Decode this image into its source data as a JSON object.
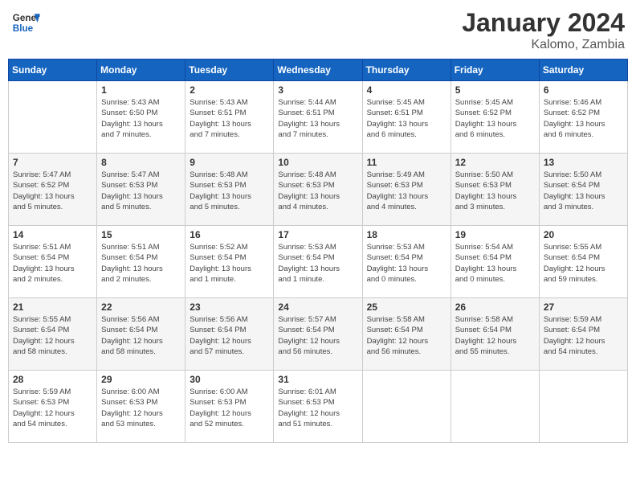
{
  "header": {
    "logo_general": "General",
    "logo_blue": "Blue",
    "month": "January 2024",
    "location": "Kalomo, Zambia"
  },
  "columns": [
    "Sunday",
    "Monday",
    "Tuesday",
    "Wednesday",
    "Thursday",
    "Friday",
    "Saturday"
  ],
  "weeks": [
    [
      {
        "day": "",
        "info": ""
      },
      {
        "day": "1",
        "info": "Sunrise: 5:43 AM\nSunset: 6:50 PM\nDaylight: 13 hours\nand 7 minutes."
      },
      {
        "day": "2",
        "info": "Sunrise: 5:43 AM\nSunset: 6:51 PM\nDaylight: 13 hours\nand 7 minutes."
      },
      {
        "day": "3",
        "info": "Sunrise: 5:44 AM\nSunset: 6:51 PM\nDaylight: 13 hours\nand 7 minutes."
      },
      {
        "day": "4",
        "info": "Sunrise: 5:45 AM\nSunset: 6:51 PM\nDaylight: 13 hours\nand 6 minutes."
      },
      {
        "day": "5",
        "info": "Sunrise: 5:45 AM\nSunset: 6:52 PM\nDaylight: 13 hours\nand 6 minutes."
      },
      {
        "day": "6",
        "info": "Sunrise: 5:46 AM\nSunset: 6:52 PM\nDaylight: 13 hours\nand 6 minutes."
      }
    ],
    [
      {
        "day": "7",
        "info": "Sunrise: 5:47 AM\nSunset: 6:52 PM\nDaylight: 13 hours\nand 5 minutes."
      },
      {
        "day": "8",
        "info": "Sunrise: 5:47 AM\nSunset: 6:53 PM\nDaylight: 13 hours\nand 5 minutes."
      },
      {
        "day": "9",
        "info": "Sunrise: 5:48 AM\nSunset: 6:53 PM\nDaylight: 13 hours\nand 5 minutes."
      },
      {
        "day": "10",
        "info": "Sunrise: 5:48 AM\nSunset: 6:53 PM\nDaylight: 13 hours\nand 4 minutes."
      },
      {
        "day": "11",
        "info": "Sunrise: 5:49 AM\nSunset: 6:53 PM\nDaylight: 13 hours\nand 4 minutes."
      },
      {
        "day": "12",
        "info": "Sunrise: 5:50 AM\nSunset: 6:53 PM\nDaylight: 13 hours\nand 3 minutes."
      },
      {
        "day": "13",
        "info": "Sunrise: 5:50 AM\nSunset: 6:54 PM\nDaylight: 13 hours\nand 3 minutes."
      }
    ],
    [
      {
        "day": "14",
        "info": "Sunrise: 5:51 AM\nSunset: 6:54 PM\nDaylight: 13 hours\nand 2 minutes."
      },
      {
        "day": "15",
        "info": "Sunrise: 5:51 AM\nSunset: 6:54 PM\nDaylight: 13 hours\nand 2 minutes."
      },
      {
        "day": "16",
        "info": "Sunrise: 5:52 AM\nSunset: 6:54 PM\nDaylight: 13 hours\nand 1 minute."
      },
      {
        "day": "17",
        "info": "Sunrise: 5:53 AM\nSunset: 6:54 PM\nDaylight: 13 hours\nand 1 minute."
      },
      {
        "day": "18",
        "info": "Sunrise: 5:53 AM\nSunset: 6:54 PM\nDaylight: 13 hours\nand 0 minutes."
      },
      {
        "day": "19",
        "info": "Sunrise: 5:54 AM\nSunset: 6:54 PM\nDaylight: 13 hours\nand 0 minutes."
      },
      {
        "day": "20",
        "info": "Sunrise: 5:55 AM\nSunset: 6:54 PM\nDaylight: 12 hours\nand 59 minutes."
      }
    ],
    [
      {
        "day": "21",
        "info": "Sunrise: 5:55 AM\nSunset: 6:54 PM\nDaylight: 12 hours\nand 58 minutes."
      },
      {
        "day": "22",
        "info": "Sunrise: 5:56 AM\nSunset: 6:54 PM\nDaylight: 12 hours\nand 58 minutes."
      },
      {
        "day": "23",
        "info": "Sunrise: 5:56 AM\nSunset: 6:54 PM\nDaylight: 12 hours\nand 57 minutes."
      },
      {
        "day": "24",
        "info": "Sunrise: 5:57 AM\nSunset: 6:54 PM\nDaylight: 12 hours\nand 56 minutes."
      },
      {
        "day": "25",
        "info": "Sunrise: 5:58 AM\nSunset: 6:54 PM\nDaylight: 12 hours\nand 56 minutes."
      },
      {
        "day": "26",
        "info": "Sunrise: 5:58 AM\nSunset: 6:54 PM\nDaylight: 12 hours\nand 55 minutes."
      },
      {
        "day": "27",
        "info": "Sunrise: 5:59 AM\nSunset: 6:54 PM\nDaylight: 12 hours\nand 54 minutes."
      }
    ],
    [
      {
        "day": "28",
        "info": "Sunrise: 5:59 AM\nSunset: 6:53 PM\nDaylight: 12 hours\nand 54 minutes."
      },
      {
        "day": "29",
        "info": "Sunrise: 6:00 AM\nSunset: 6:53 PM\nDaylight: 12 hours\nand 53 minutes."
      },
      {
        "day": "30",
        "info": "Sunrise: 6:00 AM\nSunset: 6:53 PM\nDaylight: 12 hours\nand 52 minutes."
      },
      {
        "day": "31",
        "info": "Sunrise: 6:01 AM\nSunset: 6:53 PM\nDaylight: 12 hours\nand 51 minutes."
      },
      {
        "day": "",
        "info": ""
      },
      {
        "day": "",
        "info": ""
      },
      {
        "day": "",
        "info": ""
      }
    ]
  ]
}
